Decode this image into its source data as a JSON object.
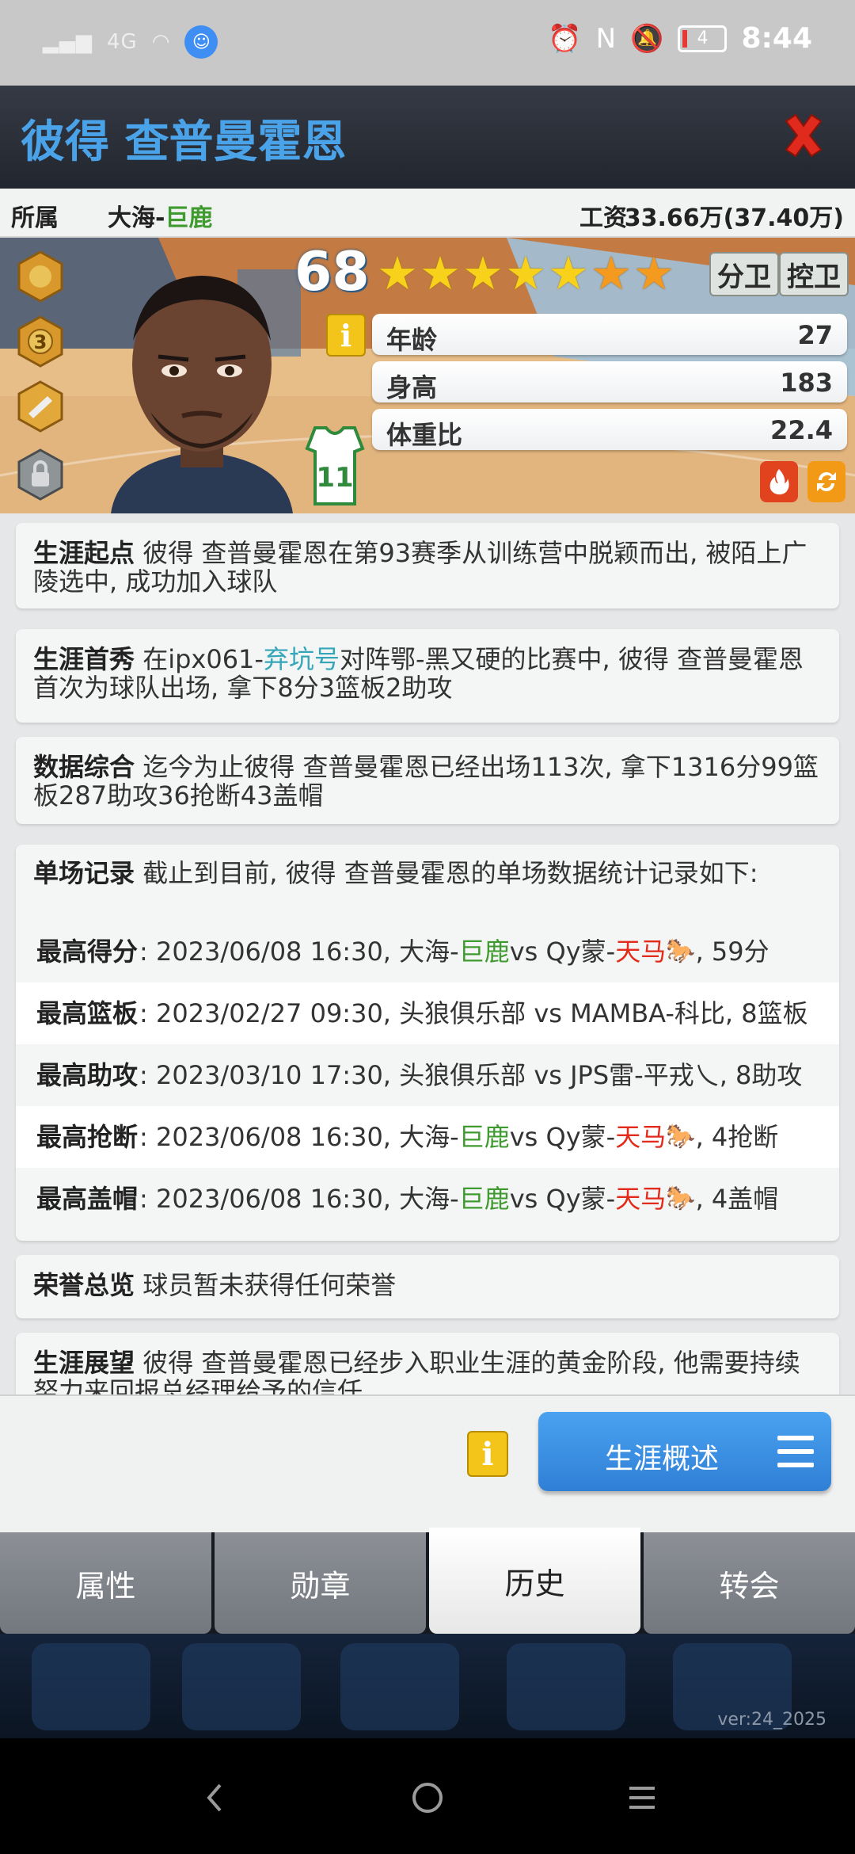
{
  "status_bar": {
    "signal_text": "4G",
    "battery": "4",
    "time": "8:44"
  },
  "header": {
    "title": "彼得 查普曼霍恩"
  },
  "info_row": {
    "team_label": "所属",
    "team_prefix": "大海-",
    "team_name": "巨鹿",
    "salary_label": "工资",
    "salary_value": "33.66万(37.40万)"
  },
  "player": {
    "overall": "68",
    "stars_full": 5,
    "stars_extra": 2,
    "positions": [
      "分卫",
      "控卫"
    ],
    "jersey_number": "11",
    "attributes": [
      {
        "label": "年龄",
        "value": "27"
      },
      {
        "label": "身高",
        "value": "183"
      },
      {
        "label": "体重比",
        "value": "22.4"
      }
    ]
  },
  "history": {
    "career_start": {
      "label": "生涯起点",
      "text": "彼得 查普曼霍恩在第93赛季从训练营中脱颖而出, 被陌上广陵选中, 成功加入球队"
    },
    "debut": {
      "label": "生涯首秀",
      "text_a": "在ipx061-",
      "team_highlight": "弃坑号",
      "text_b": "对阵鄂-黑又硬的比赛中, 彼得 查普曼霍恩首次为球队出场, 拿下8分3篮板2助攻"
    },
    "summary": {
      "label": "数据综合",
      "text": "迄今为止彼得 查普曼霍恩已经出场113次, 拿下1316分99篮板287助攻36抢断43盖帽"
    },
    "records": {
      "label": "单场记录",
      "text": "截止到目前, 彼得 查普曼霍恩的单场数据统计记录如下:",
      "rows": [
        {
          "label": "最高得分",
          "date": ": 2023/06/08 16:30, 大海-",
          "home_hl": "巨鹿",
          "vs": " vs Qy蒙-",
          "away_hl": "天马",
          "emoji": "🐎",
          "stat": ", 59分"
        },
        {
          "label": "最高篮板",
          "date": ": 2023/02/27 09:30, 头狼俱乐部 vs MAMBA-科比",
          "home_hl": "",
          "vs": "",
          "away_hl": "",
          "emoji": "",
          "stat": ", 8篮板"
        },
        {
          "label": "最高助攻",
          "date": ": 2023/03/10 17:30, 头狼俱乐部 vs JPS雷-平戎乀",
          "home_hl": "",
          "vs": "",
          "away_hl": "",
          "emoji": "",
          "stat": ", 8助攻"
        },
        {
          "label": "最高抢断",
          "date": ": 2023/06/08 16:30, 大海-",
          "home_hl": "巨鹿",
          "vs": " vs Qy蒙-",
          "away_hl": "天马",
          "emoji": "🐎",
          "stat": ", 4抢断"
        },
        {
          "label": "最高盖帽",
          "date": ": 2023/06/08 16:30, 大海-",
          "home_hl": "巨鹿",
          "vs": " vs Qy蒙-",
          "away_hl": "天马",
          "emoji": "🐎",
          "stat": ", 4盖帽"
        }
      ]
    },
    "honors": {
      "label": "荣誉总览",
      "text": "球员暂未获得任何荣誉"
    },
    "outlook": {
      "label": "生涯展望",
      "text": "彼得 查普曼霍恩已经步入职业生涯的黄金阶段, 他需要持续努力来回报总经理给予的信任"
    }
  },
  "bottom_panel": {
    "info_glyph": "i",
    "career_button": "生涯概述"
  },
  "tabs": [
    {
      "label": "属性",
      "active": false
    },
    {
      "label": "勋章",
      "active": false
    },
    {
      "label": "历史",
      "active": true
    },
    {
      "label": "转会",
      "active": false
    }
  ],
  "footer": {
    "version": "ver:24_2025"
  },
  "colors": {
    "title_blue": "#4aa3e8",
    "highlight_green": "#3f9a2f",
    "highlight_red": "#e22b1a",
    "highlight_cyan": "#34a6b7",
    "button_blue": "#3a8fe3",
    "info_yellow": "#f3c41a"
  }
}
